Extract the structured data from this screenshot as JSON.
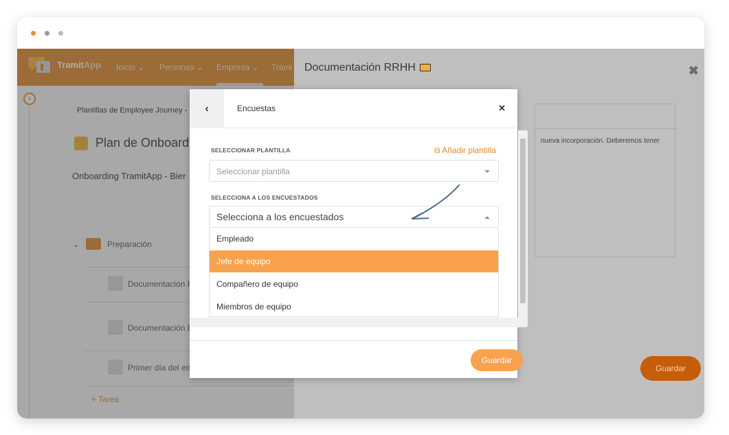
{
  "colors": {
    "brand_orange": "#e08a2a",
    "highlight": "#f8a24d",
    "save_dark": "#c65d08"
  },
  "navbar": {
    "brand_a": "Tramit",
    "brand_b": "App",
    "items": [
      "Inicio ⌄",
      "Personas ⌄",
      "Empresa ⌄",
      "Trámi"
    ]
  },
  "background": {
    "breadcrumb": "Plantillas de Employee Journey -",
    "plan_title": "Plan de Onboardi",
    "plan_subtitle": "Onboarding TramitApp - Bier",
    "section": "Preparación",
    "tasks": [
      "Documentación R",
      "Documentación E",
      "Primer día del em"
    ],
    "add_task": "Tarea"
  },
  "panel": {
    "title": "Documentación RRHH",
    "snippet": "nueva incorporación. Deberemos tener",
    "save": "Guardar"
  },
  "modal": {
    "title": "Encuestas",
    "template_label": "SELECCIONAR PLANTILLA",
    "add_template": "Añadir plantilla",
    "template_placeholder": "Seleccionar plantilla",
    "respondents_label": "SELECCIONA A LOS ENCUESTADOS",
    "respondents_placeholder": "Selecciona a los encuestados",
    "options": [
      "Empleado",
      "Jefe de equipo",
      "Compañero de equipo",
      "Miembros de equipo"
    ],
    "selected_option": "Jefe de equipo",
    "save": "Guardar"
  }
}
